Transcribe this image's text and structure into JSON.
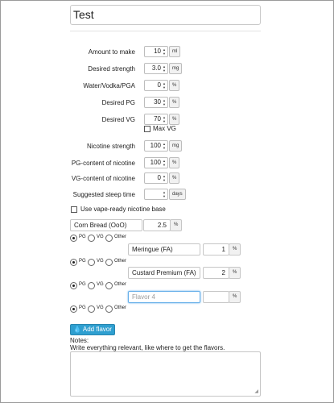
{
  "recipe": {
    "name": "Test"
  },
  "fields": [
    {
      "label": "Amount to make",
      "value": "10",
      "unit": "ml"
    },
    {
      "label": "Desired strength",
      "value": "3.0",
      "unit": "mg"
    },
    {
      "label": "Water/Vodka/PGA",
      "value": "0",
      "unit": "%"
    },
    {
      "label": "Desired PG",
      "value": "30",
      "unit": "%"
    },
    {
      "label": "Desired VG",
      "value": "70",
      "unit": "%"
    },
    {
      "label": "Nicotine strength",
      "value": "100",
      "unit": "mg"
    },
    {
      "label": "PG-content of nicotine",
      "value": "100",
      "unit": "%"
    },
    {
      "label": "VG-content of nicotine",
      "value": "0",
      "unit": "%"
    },
    {
      "label": "Suggested steep time",
      "value": "",
      "unit": "days"
    }
  ],
  "max_vg": {
    "label": "Max VG",
    "checked": false
  },
  "vape_ready": {
    "label": "Use vape-ready nicotine base",
    "checked": false
  },
  "flavors": [
    {
      "name": "Corn Bread (OoO)",
      "percent": "2.5",
      "unit": "%",
      "placeholder": "",
      "base": "PG"
    },
    {
      "name": "Meringue (FA)",
      "percent": "1",
      "unit": "%",
      "placeholder": "",
      "base": "PG"
    },
    {
      "name": "Custard Premium (FA)",
      "percent": "2",
      "unit": "%",
      "placeholder": "",
      "base": "PG"
    },
    {
      "name": "",
      "percent": "",
      "unit": "%",
      "placeholder": "Flavor 4",
      "base": "PG"
    }
  ],
  "base_options": [
    "PG",
    "VG",
    "Other"
  ],
  "buttons": {
    "add_flavor": "Add flavor"
  },
  "icons": {
    "add_flavor": "droplet-icon"
  },
  "notes": {
    "label": "Notes:",
    "hint": "Write everything relevant, like where to get the flavors.",
    "value": ""
  },
  "colors": {
    "accent": "#2f9fd0"
  }
}
